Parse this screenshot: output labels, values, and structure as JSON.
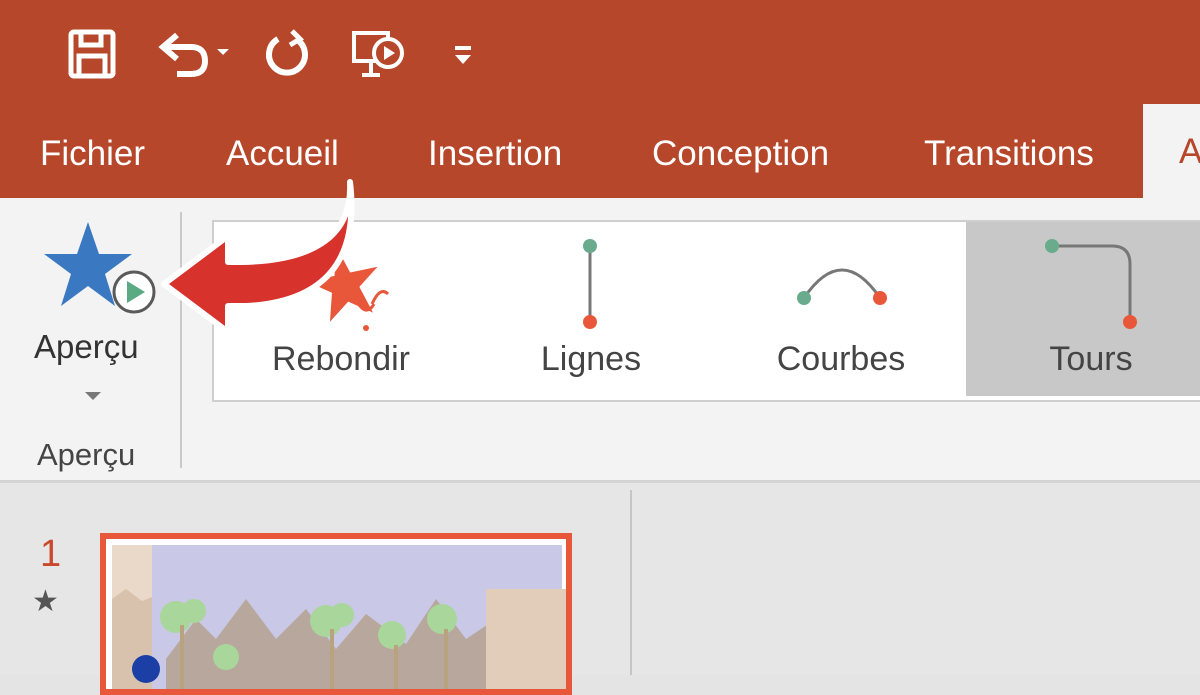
{
  "quick_access": {
    "save_icon": "save-icon",
    "undo_icon": "undo-icon",
    "redo_icon": "repeat-icon",
    "slideshow_icon": "present-from-start-icon",
    "customize_icon": "customize-toolbar-icon"
  },
  "tabs": [
    {
      "label": "Fichier"
    },
    {
      "label": "Accueil"
    },
    {
      "label": "Insertion"
    },
    {
      "label": "Conception"
    },
    {
      "label": "Transitions"
    }
  ],
  "active_tab": {
    "label": "A"
  },
  "preview_group": {
    "button_label": "Aperçu",
    "group_label": "Aperçu",
    "icon": "star-play-icon"
  },
  "annotation": {
    "icon": "red-curved-arrow-icon",
    "color": "#d7322b"
  },
  "animation_gallery": [
    {
      "label": "Rebondir",
      "icon": "bounce-icon",
      "selected": false
    },
    {
      "label": "Lignes",
      "icon": "lines-path-icon",
      "selected": false
    },
    {
      "label": "Courbes",
      "icon": "arcs-path-icon",
      "selected": false
    },
    {
      "label": "Tours",
      "icon": "turns-path-icon",
      "selected": true
    }
  ],
  "slide_panel": {
    "slide_number": "1",
    "animation_marker": "★"
  },
  "colors": {
    "brand": "#b7472a",
    "ribbon_bg": "#f3f3f3",
    "accent_orange": "#e8573a",
    "path_green": "#6aab8e"
  }
}
